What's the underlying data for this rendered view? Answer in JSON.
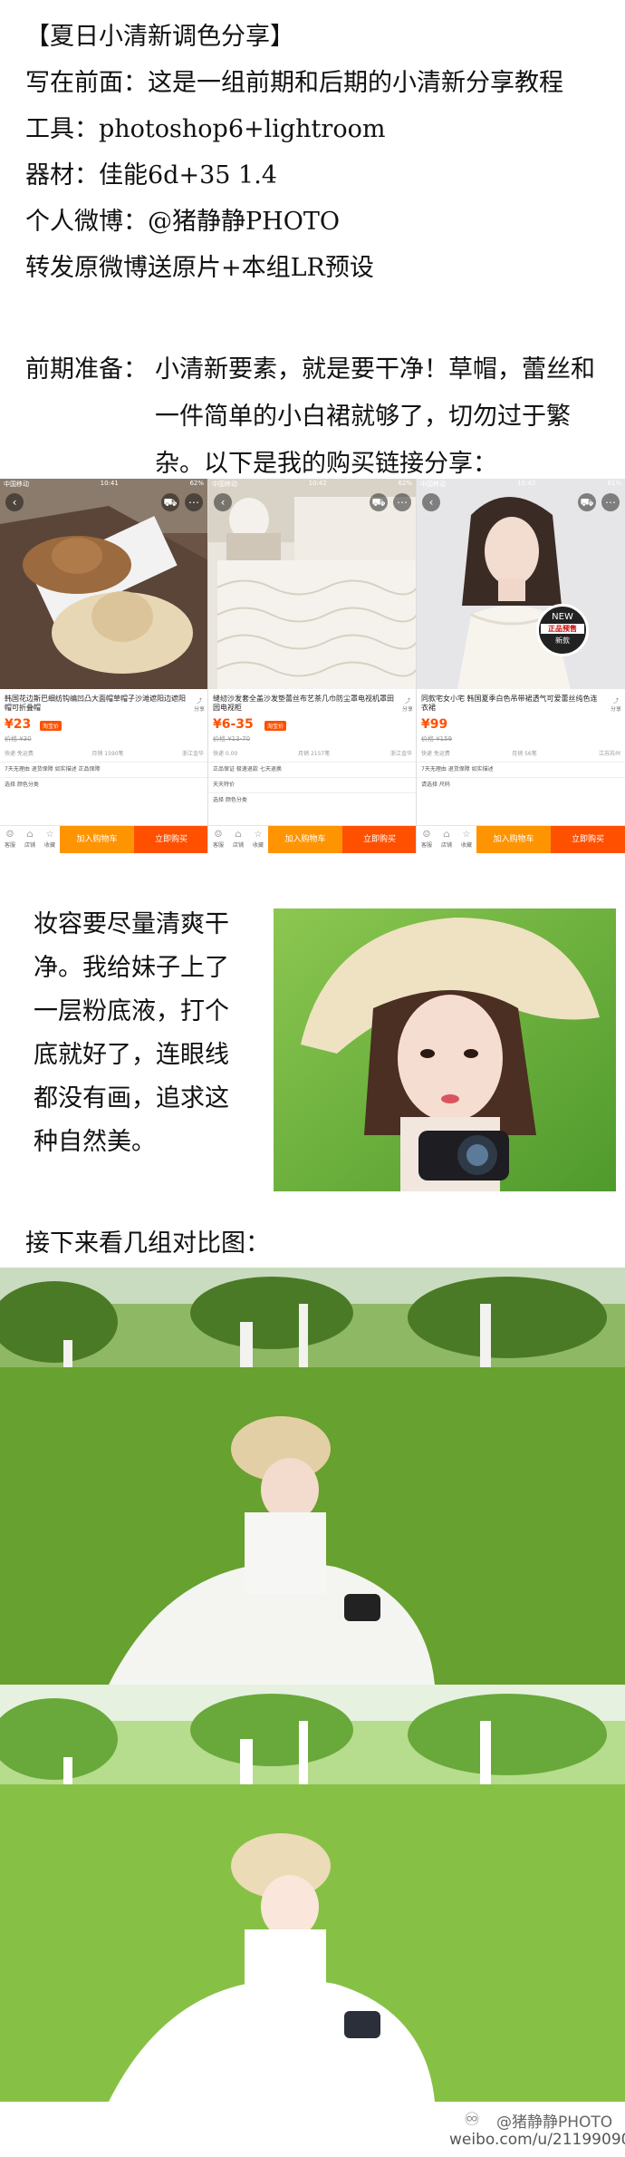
{
  "intro": {
    "title": "【夏日小清新调色分享】",
    "line1": "写在前面：这是一组前期和后期的小清新分享教程",
    "line2": "工具：photoshop6+lightroom",
    "line3": "器材：佳能6d+35 1.4",
    "line4": "个人微博：@猪静静PHOTO",
    "line5": "转发原微博送原片+本组LR预设"
  },
  "prep": {
    "label": "前期准备：",
    "body": "小清新要素，就是要干净！草帽，蕾丝和一件简单的小白裙就够了，切勿过于繁杂。以下是我的购买链接分享："
  },
  "shop": {
    "cards": [
      {
        "time": "10:41",
        "carrier": "中国移动",
        "battery": "62%",
        "title": "韩国花边斯巴细纺钩编凹凸大面帽草帽子沙滩遮阳边遮阳帽可折叠帽",
        "price": "¥23",
        "old_price": "价格 ¥30",
        "tag": "淘宝价",
        "stats": [
          "快递 免运费",
          "月销 1590笔",
          "浙江金华"
        ],
        "rows": [
          "7天无理由  退货保障  如实描述  正品保障",
          "选择 颜色分类"
        ],
        "add_cart": "加入购物车",
        "buy_now": "立即购买",
        "nav": [
          "客服",
          "店铺",
          "收藏"
        ],
        "share": "分享"
      },
      {
        "time": "10:42",
        "carrier": "中国移动",
        "battery": "62%",
        "title": "缝纫沙发套全盖沙发垫蕾丝布艺茶几巾防尘罩电视机罩田园电视柜",
        "price": "¥6-35",
        "old_price": "价格 ¥13-70",
        "tag": "淘宝价",
        "stats": [
          "快递 0.00",
          "月销 2157笔",
          "浙江金华"
        ],
        "rows": [
          "正品保证  极速退款  七天退换",
          "天天特价",
          "选择 颜色分类"
        ],
        "add_cart": "加入购物车",
        "buy_now": "立即购买",
        "nav": [
          "客服",
          "店铺",
          "收藏"
        ],
        "share": "分享"
      },
      {
        "time": "10:42",
        "carrier": "中国移动",
        "battery": "61%",
        "title": "同款宅女小宅 韩国夏季白色吊带裙透气可爱蕾丝纯色连衣裙",
        "price": "¥99",
        "old_price": "价格 ¥159",
        "tag": "",
        "badge_top": "NEW",
        "badge_mid": "正品预售",
        "badge_bot": "新款",
        "stats": [
          "快递 免运费",
          "月销 56笔",
          "江苏苏州"
        ],
        "rows": [
          "7天无理由  退货保障  如实描述",
          "请选择 尺码"
        ],
        "add_cart": "加入购物车",
        "buy_now": "立即购买",
        "nav": [
          "客服",
          "店铺",
          "收藏"
        ],
        "share": "分享"
      }
    ]
  },
  "makeup": {
    "text": "妆容要尽量清爽干净。我给妹子上了一层粉底液，打个底就好了，连眼线都没有画，追求这种自然美。"
  },
  "compare": {
    "text": "接下来看几组对比图："
  },
  "watermark": {
    "name": "@猪静静PHOTO",
    "url": "weibo.com/u/2119909074"
  },
  "colors": {
    "price_orange": "#ff5000",
    "cart_orange": "#ff9402",
    "grass_green": "#6fae2a"
  }
}
